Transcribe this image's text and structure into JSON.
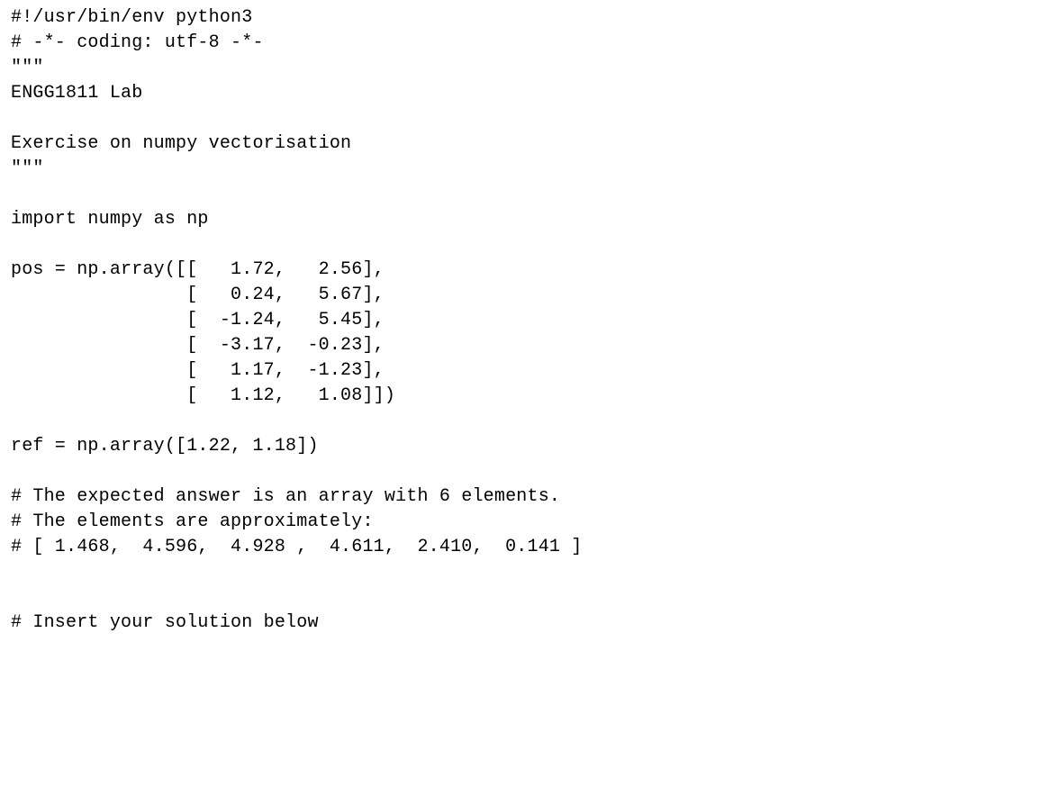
{
  "code": {
    "lines": [
      "#!/usr/bin/env python3",
      "# -*- coding: utf-8 -*-",
      "\"\"\"",
      "ENGG1811 Lab",
      "",
      "Exercise on numpy vectorisation",
      "\"\"\"",
      "",
      "import numpy as np",
      "",
      "pos = np.array([[   1.72,   2.56],",
      "                [   0.24,   5.67],",
      "                [  -1.24,   5.45],",
      "                [  -3.17,  -0.23],",
      "                [   1.17,  -1.23],",
      "                [   1.12,   1.08]])",
      "",
      "ref = np.array([1.22, 1.18])",
      "",
      "# The expected answer is an array with 6 elements.",
      "# The elements are approximately:",
      "# [ 1.468,  4.596,  4.928 ,  4.611,  2.410,  0.141 ]",
      "",
      "",
      "# Insert your solution below"
    ]
  }
}
